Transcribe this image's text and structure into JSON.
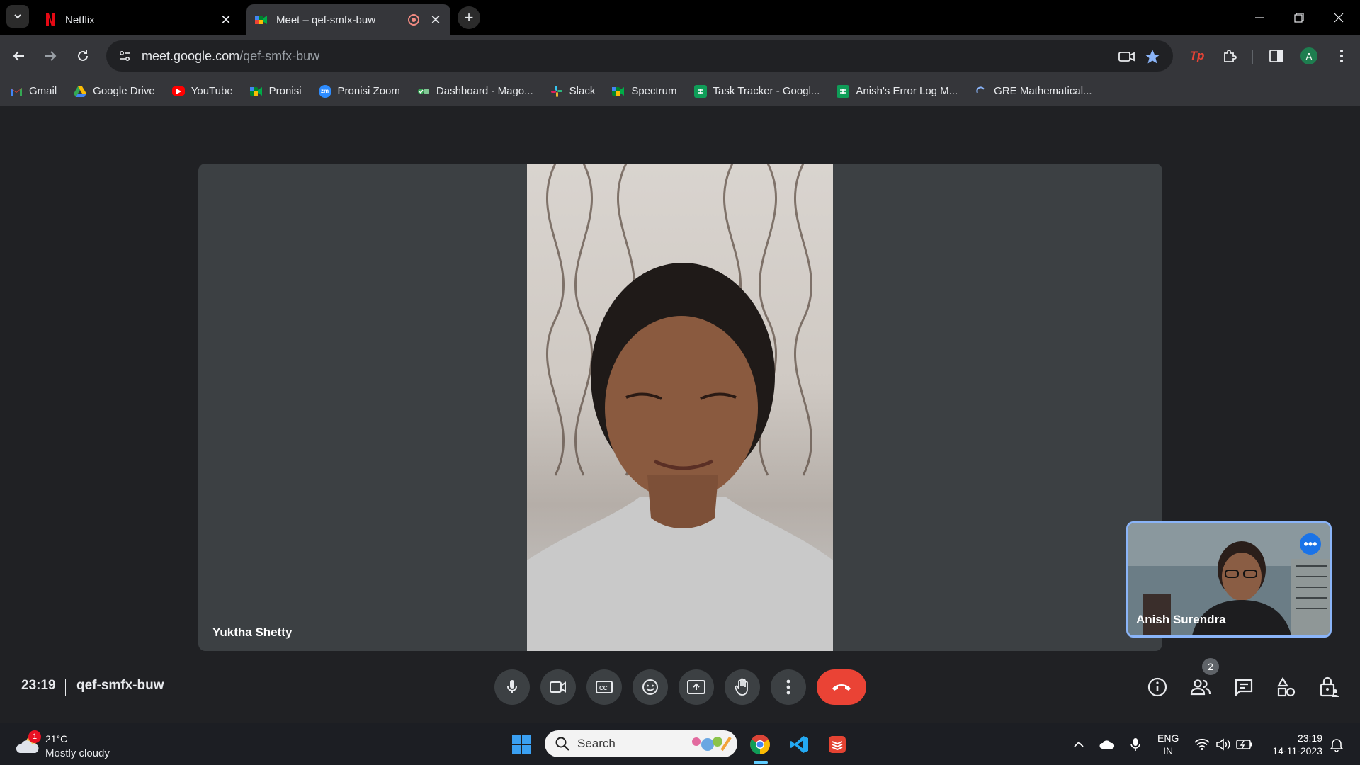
{
  "browser": {
    "tabs": [
      {
        "title": "Netflix",
        "favicon": "netflix-icon",
        "active": false
      },
      {
        "title": "Meet – qef-smfx-buw",
        "favicon": "google-meet-icon",
        "active": true
      }
    ],
    "address": {
      "host": "meet.google.com",
      "path": "/qef-smfx-buw"
    },
    "profile_initial": "A"
  },
  "bookmarks": [
    {
      "label": "Gmail",
      "icon": "gmail-icon"
    },
    {
      "label": "Google Drive",
      "icon": "google-drive-icon"
    },
    {
      "label": "YouTube",
      "icon": "youtube-icon"
    },
    {
      "label": "Pronisi",
      "icon": "google-meet-icon"
    },
    {
      "label": "Pronisi Zoom",
      "icon": "zoom-icon"
    },
    {
      "label": "Dashboard - Mago...",
      "icon": "dashboard-icon"
    },
    {
      "label": "Slack",
      "icon": "slack-icon"
    },
    {
      "label": "Spectrum",
      "icon": "google-meet-icon"
    },
    {
      "label": "Task Tracker - Googl...",
      "icon": "google-sheets-icon"
    },
    {
      "label": "Anish's Error Log M...",
      "icon": "google-sheets-icon"
    },
    {
      "label": "GRE Mathematical...",
      "icon": "loading-icon"
    }
  ],
  "meet": {
    "main_participant": "Yuktha Shetty",
    "self_participant": "Anish Surendra",
    "time": "23:19",
    "meeting_code": "qef-smfx-buw",
    "people_count": "2",
    "end_call_color": "#ea4335"
  },
  "taskbar": {
    "weather": {
      "alert_count": "1",
      "temp": "21°C",
      "condition": "Mostly cloudy"
    },
    "search_label": "Search",
    "language": {
      "line1": "ENG",
      "line2": "IN"
    },
    "clock": {
      "time": "23:19",
      "date": "14-11-2023"
    }
  }
}
